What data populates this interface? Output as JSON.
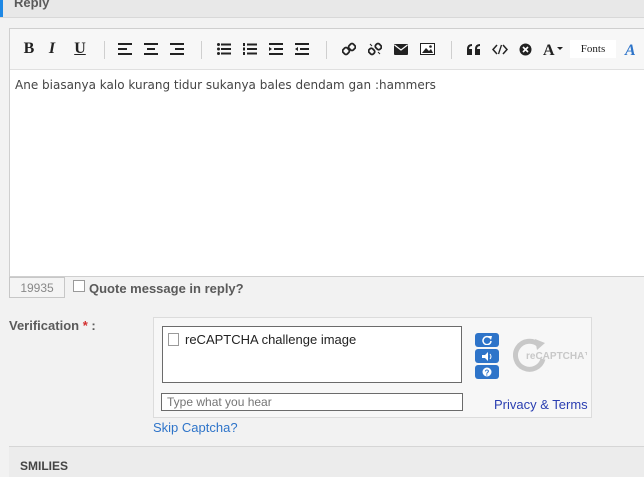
{
  "reply": {
    "title": "Reply"
  },
  "toolbar": {
    "bold": "B",
    "italic": "I",
    "underline": "U",
    "fonts_label": "Fonts",
    "icons": [
      "bold-icon",
      "italic-icon",
      "underline-icon",
      "align-left-icon",
      "align-center-icon",
      "align-right-icon",
      "bullet-list-icon",
      "numbered-list-icon",
      "indent-icon",
      "outdent-icon",
      "link-icon",
      "unlink-icon",
      "email-icon",
      "image-icon",
      "quote-icon",
      "code-icon",
      "clear-format-icon",
      "font-size-icon",
      "font-color-icon"
    ]
  },
  "editor": {
    "content": "Ane biasanya kalo kurang tidur sukanya bales dendam gan :hammers"
  },
  "char_count": "19935",
  "quote": {
    "label": "Quote message in reply?",
    "checked": false
  },
  "verification": {
    "label": "Verification",
    "required_mark": "*",
    "suffix": ":"
  },
  "captcha": {
    "image_alt": "reCAPTCHA challenge image",
    "input_placeholder": "Type what you hear",
    "privacy_terms": "Privacy & Terms",
    "skip_label": "Skip Captcha?",
    "logo_text": "reCAPTCHA™",
    "accent_color": "#2e74c9"
  },
  "smilies": {
    "label": "SMILIES"
  }
}
